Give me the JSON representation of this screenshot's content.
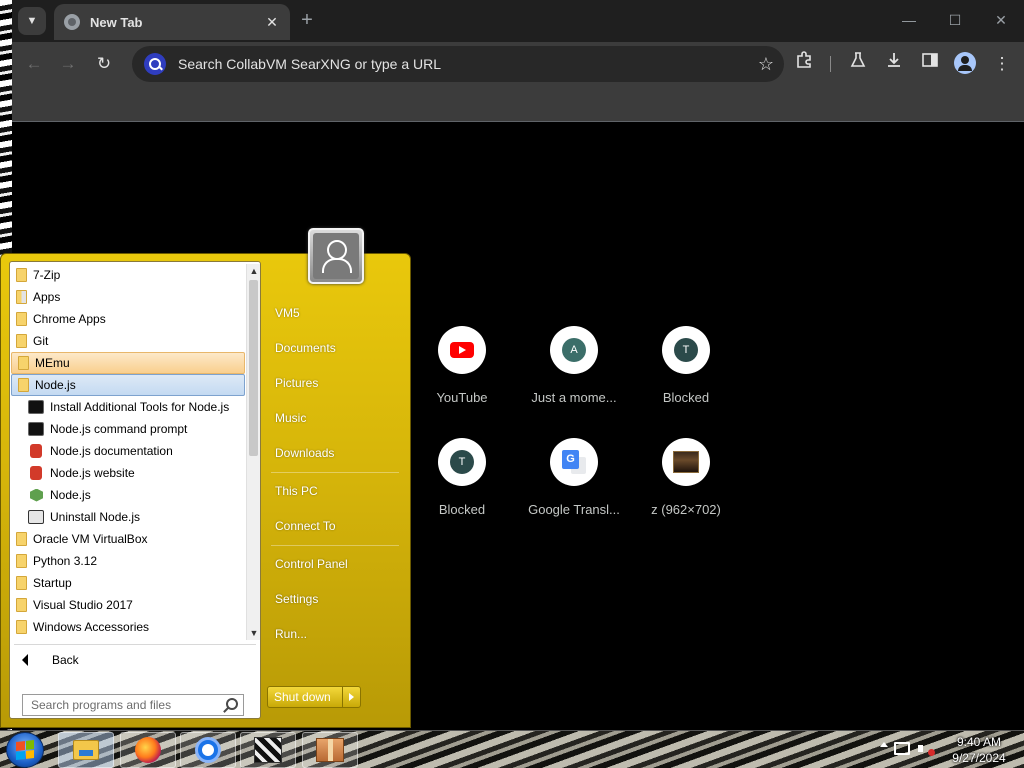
{
  "browser": {
    "tab_title": "New Tab",
    "tab_close": "✕",
    "new_tab": "+",
    "window_minimize": "—",
    "window_maximize": "☐",
    "window_close": "✕",
    "omnibox_placeholder": "Search CollabVM SearXNG or type a URL",
    "star": "☆"
  },
  "shortcuts": [
    {
      "label": "YouTube",
      "icon": "youtube-icon"
    },
    {
      "label": "Just a mome...",
      "letter": "A",
      "icon": "letter-icon"
    },
    {
      "label": "Blocked",
      "letter": "T",
      "icon": "letter-icon"
    },
    {
      "label": "Blocked",
      "letter": "T",
      "icon": "letter-icon"
    },
    {
      "label": "Google Transl...",
      "icon": "google-translate-icon"
    },
    {
      "label": "z (962×702)",
      "icon": "image-thumbnail-icon"
    }
  ],
  "start_menu": {
    "programs": [
      {
        "label": "7-Zip",
        "icon": "folder-icon"
      },
      {
        "label": "Apps",
        "icon": "apps-folder-icon"
      },
      {
        "label": "Chrome Apps",
        "icon": "folder-icon"
      },
      {
        "label": "Git",
        "icon": "folder-icon"
      },
      {
        "label": "MEmu",
        "icon": "folder-icon",
        "state": "hover"
      },
      {
        "label": "Node.js",
        "icon": "folder-icon",
        "state": "selected"
      },
      {
        "label": "Install Additional Tools for Node.js",
        "icon": "cmd-icon",
        "sub": true
      },
      {
        "label": "Node.js command prompt",
        "icon": "cmd-icon",
        "sub": true
      },
      {
        "label": "Node.js documentation",
        "icon": "doc-icon",
        "sub": true
      },
      {
        "label": "Node.js website",
        "icon": "doc-icon",
        "sub": true
      },
      {
        "label": "Node.js",
        "icon": "nodejs-icon",
        "sub": true
      },
      {
        "label": "Uninstall Node.js",
        "icon": "uninstall-icon",
        "sub": true
      },
      {
        "label": "Oracle VM VirtualBox",
        "icon": "folder-icon"
      },
      {
        "label": "Python 3.12",
        "icon": "folder-icon"
      },
      {
        "label": "Startup",
        "icon": "folder-icon"
      },
      {
        "label": "Visual Studio 2017",
        "icon": "folder-icon"
      },
      {
        "label": "Windows Accessories",
        "icon": "folder-icon"
      }
    ],
    "back_label": "Back",
    "search_placeholder": "Search programs and files",
    "right_links": [
      "VM5",
      "Documents",
      "Pictures",
      "Music",
      "Downloads",
      "This PC",
      "Connect To",
      "Control Panel",
      "Settings",
      "Run..."
    ],
    "shutdown_label": "Shut down"
  },
  "tray": {
    "time": "9:40 AM",
    "date": "9/27/2024"
  }
}
